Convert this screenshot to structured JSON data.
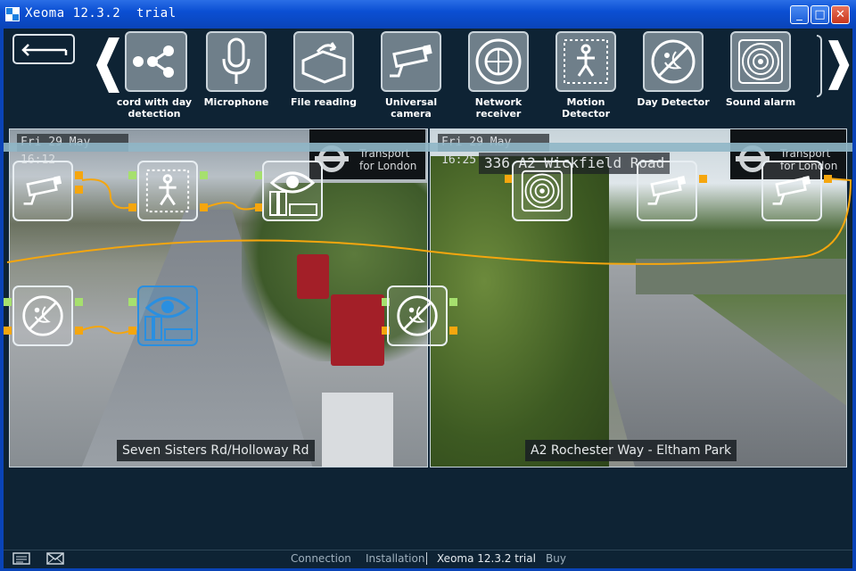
{
  "window": {
    "title": "Xeoma 12.3.2  trial",
    "minimize": "_",
    "maximize": "□",
    "close": "✕"
  },
  "toolbar": {
    "back_icon": "back-arrow-icon",
    "prev_icon": "chevron-left-icon",
    "next_icon": "chevron-right-icon",
    "items": [
      {
        "label": "cord with day\ndetection",
        "icon": "record-scheduler-icon"
      },
      {
        "label": "Microphone",
        "icon": "microphone-icon"
      },
      {
        "label": "File reading",
        "icon": "file-reading-icon"
      },
      {
        "label": "Universal\ncamera",
        "icon": "camera-icon"
      },
      {
        "label": "Network receiver",
        "icon": "network-receiver-icon"
      },
      {
        "label": "Motion Detector",
        "icon": "motion-detector-icon"
      },
      {
        "label": "Day Detector",
        "icon": "day-detector-icon"
      },
      {
        "label": "Sound alarm",
        "icon": "sound-alarm-icon"
      }
    ]
  },
  "cameras": [
    {
      "date": "Fri 29 May 16:12",
      "tfl_line1": "Transport",
      "tfl_line2": "for London",
      "location": "Seven Sisters Rd/Holloway Rd"
    },
    {
      "date": "Fri 29 May 16:25",
      "tfl_line1": "Transport",
      "tfl_line2": "for London",
      "road_label": "336 A2 Wickfield Road",
      "location": "A2 Rochester Way - Eltham Park"
    }
  ],
  "statusbar": {
    "connection": "Connection",
    "installation": "Installation",
    "version": "Xeoma 12.3.2  trial",
    "buy": "Buy"
  },
  "colors": {
    "titlebar": "#0b4fd3",
    "background": "#0e2334",
    "wire": "#f5a60e",
    "audio_port": "#a6e06e",
    "selected": "#2a8fe0"
  }
}
